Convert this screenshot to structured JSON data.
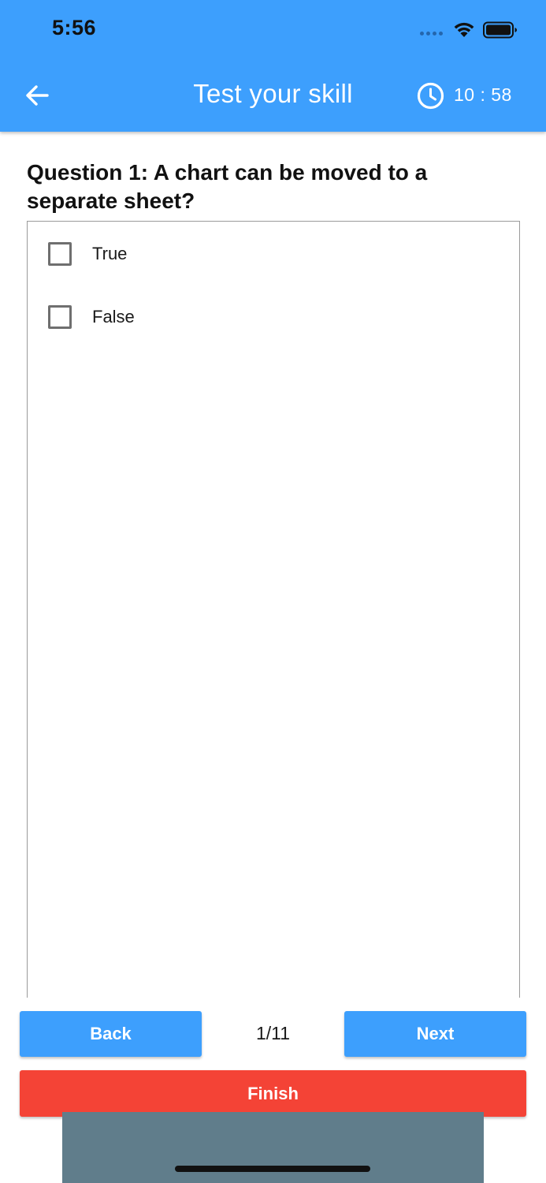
{
  "status_bar": {
    "time": "5:56",
    "icons": [
      "signal-dots-icon",
      "wifi-icon",
      "battery-icon"
    ]
  },
  "app_bar": {
    "title": "Test your skill",
    "timer": "10 : 58",
    "icons": {
      "back": "arrow-left-icon",
      "timer": "clock-icon"
    }
  },
  "question": {
    "title": "Question 1: A chart can be moved to a separate sheet?",
    "options": [
      {
        "label": "True",
        "checked": false
      },
      {
        "label": "False",
        "checked": false
      }
    ]
  },
  "navigation": {
    "back_label": "Back",
    "next_label": "Next",
    "page_indicator": "1/11",
    "finish_label": "Finish"
  },
  "colors": {
    "primary": "#3d9ffd",
    "finish": "#f44336",
    "bottom_strip": "#607d8b"
  }
}
